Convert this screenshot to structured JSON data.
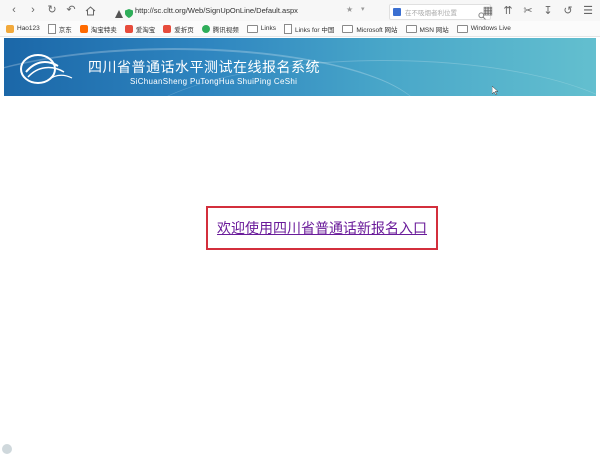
{
  "browser": {
    "url": "http://sc.cltt.org/Web/SignUpOnLine/Default.aspx",
    "search_placeholder": "在不吸烟者利位置"
  },
  "bookmarks": [
    {
      "label": "Hao123",
      "icon": "hao123-icon",
      "color": "#f2a93b"
    },
    {
      "label": "京东",
      "icon": "file-icon"
    },
    {
      "label": "淘宝特卖",
      "icon": "taobao-icon",
      "color": "#ff6a00"
    },
    {
      "label": "爱淘宝",
      "icon": "aitaobao-icon",
      "color": "#e74c3c"
    },
    {
      "label": "爱折页",
      "icon": "aizhe-icon",
      "color": "#e74c3c"
    },
    {
      "label": "腾讯视频",
      "icon": "tencent-video-icon",
      "color": "#2fae5a"
    },
    {
      "label": "Links",
      "icon": "folder-icon"
    },
    {
      "label": "Links for 中国",
      "icon": "file-icon"
    },
    {
      "label": "Microsoft 网站",
      "icon": "folder-icon"
    },
    {
      "label": "MSN 网站",
      "icon": "folder-icon"
    },
    {
      "label": "Windows Live",
      "icon": "folder-icon"
    }
  ],
  "banner": {
    "title": "四川省普通话水平测试在线报名系统",
    "subtitle": "SiChuanSheng  PuTongHua ShuiPing CeShi"
  },
  "main": {
    "entry_link": "欢迎使用四川省普通话新报名入口",
    "highlight_color": "#d32f3c"
  }
}
